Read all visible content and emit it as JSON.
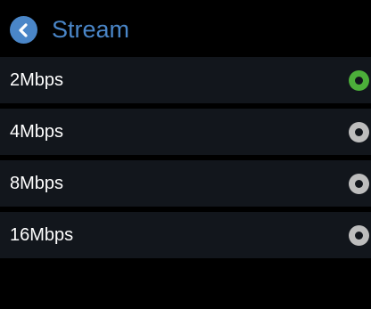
{
  "header": {
    "back_icon": "chevron-left-icon",
    "title": "Stream"
  },
  "colors": {
    "accent": "#4a86c8",
    "selected": "#4caf3a",
    "unselected": "#bdbdbd",
    "row_background": "#12161c",
    "background": "#000000"
  },
  "options": [
    {
      "label": "2Mbps",
      "selected": true
    },
    {
      "label": "4Mbps",
      "selected": false
    },
    {
      "label": "8Mbps",
      "selected": false
    },
    {
      "label": "16Mbps",
      "selected": false
    }
  ]
}
